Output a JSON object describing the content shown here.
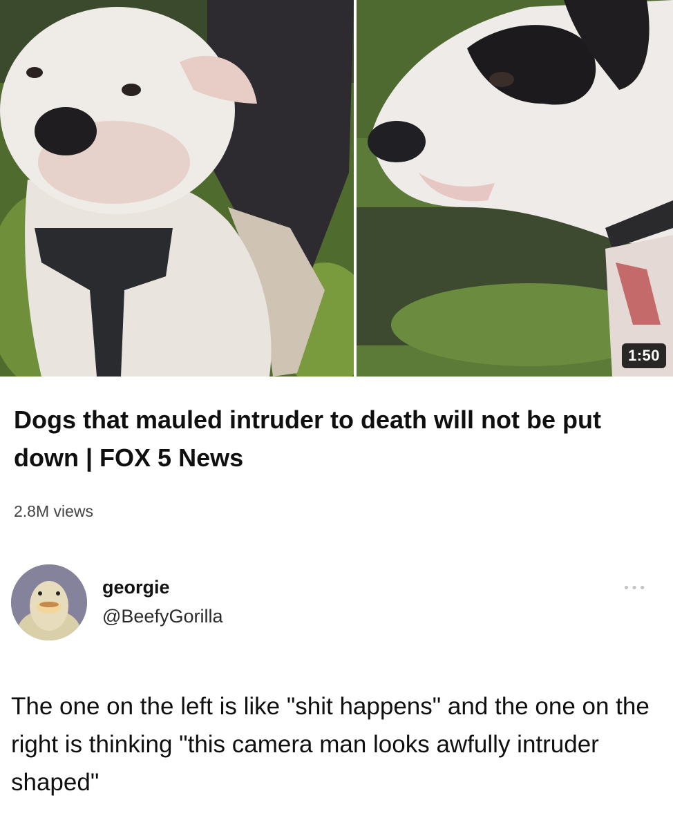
{
  "video": {
    "left_thumbnail_icon": "dog-left-photo",
    "right_thumbnail_icon": "dog-right-photo",
    "duration": "1:50",
    "title": "Dogs that mauled intruder to death will not be put down | FOX 5 News",
    "views": "2.8M views"
  },
  "tweet": {
    "avatar_icon": "duck-avatar",
    "display_name": "georgie",
    "handle": "@BeefyGorilla",
    "more_icon": "ellipsis-icon",
    "more_label": "•••",
    "text": "The one on the left is like \"shit happens\" and the one on the right is thinking \"this camera man looks awfully intruder shaped\""
  }
}
